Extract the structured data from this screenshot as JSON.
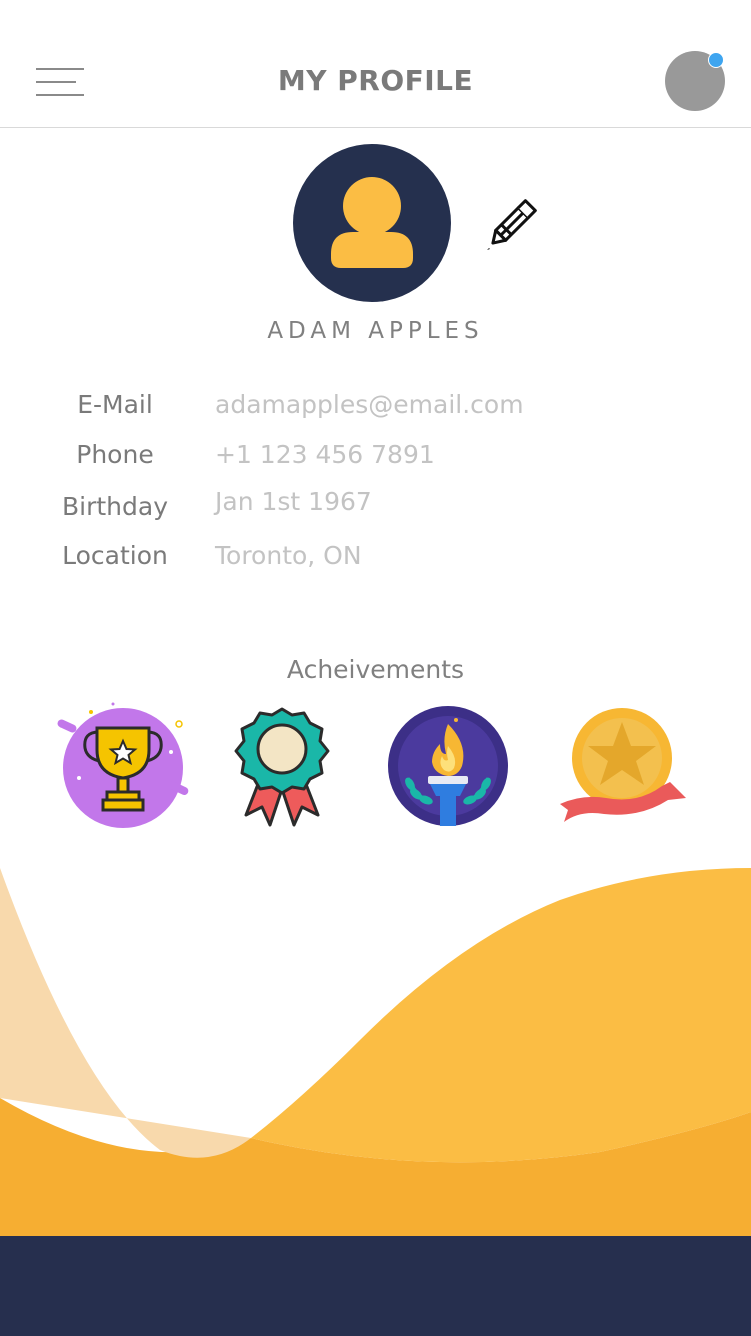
{
  "header": {
    "title": "MY PROFILE",
    "menu_icon": "hamburger-menu-icon",
    "account_icon": "user-avatar",
    "has_notification": true
  },
  "profile": {
    "name": "ADAM APPLES",
    "avatar_icon": "user-silhouette-icon",
    "edit_icon": "pencil-icon",
    "fields": [
      {
        "label": "E-Mail",
        "value": "adamapples@email.com"
      },
      {
        "label": "Phone",
        "value": "+1 123 456 7891"
      },
      {
        "label": "Birthday",
        "value": "Jan 1st 1967"
      },
      {
        "label": "Location",
        "value": "Toronto, ON"
      }
    ]
  },
  "achievements": {
    "title": "Acheivements",
    "badges": [
      "trophy-badge-icon",
      "rosette-badge-icon",
      "torch-badge-icon",
      "star-medal-badge-icon"
    ]
  },
  "colors": {
    "navy": "#262f4e",
    "accent_yellow": "#fbbd44",
    "notification_blue": "#3ea5f0"
  }
}
